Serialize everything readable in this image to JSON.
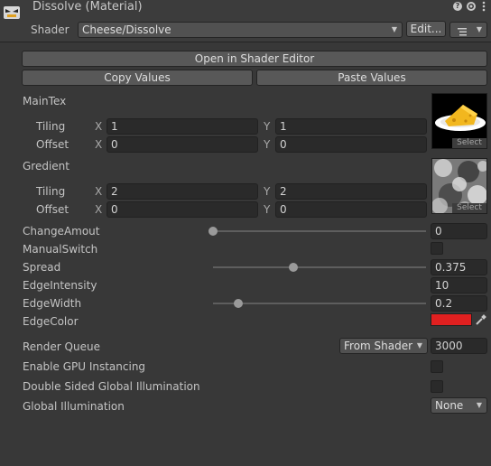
{
  "header": {
    "title": "Dissolve (Material)",
    "shader_label": "Shader",
    "shader_value": "Cheese/Dissolve",
    "edit_label": "Edit...",
    "menu_icon": "list-menu-icon",
    "help_icon": "help-icon",
    "settings_icon": "settings-icon",
    "more_icon": "kebab-icon"
  },
  "actions": {
    "open_shader_editor": "Open in Shader Editor",
    "copy_values": "Copy Values",
    "paste_values": "Paste Values"
  },
  "textures": [
    {
      "name": "MainTex",
      "tiling_label": "Tiling",
      "offset_label": "Offset",
      "tiling_x": "1",
      "tiling_y": "1",
      "offset_x": "0",
      "offset_y": "0",
      "select_label": "Select"
    },
    {
      "name": "Gredient",
      "tiling_label": "Tiling",
      "offset_label": "Offset",
      "tiling_x": "2",
      "tiling_y": "2",
      "offset_x": "0",
      "offset_y": "0",
      "select_label": "Select"
    }
  ],
  "axis": {
    "x": "X",
    "y": "Y"
  },
  "properties": {
    "change_amount": {
      "label": "ChangeAmout",
      "value": "0",
      "slider_fraction": 0.0
    },
    "manual_switch": {
      "label": "ManualSwitch",
      "checked": false
    },
    "spread": {
      "label": "Spread",
      "value": "0.375",
      "slider_fraction": 0.375
    },
    "edge_intensity": {
      "label": "EdgeIntensity",
      "value": "10"
    },
    "edge_width": {
      "label": "EdgeWidth",
      "value": "0.2",
      "slider_fraction": 0.12
    },
    "edge_color": {
      "label": "EdgeColor",
      "color": "#e02020"
    }
  },
  "advanced": {
    "render_queue_label": "Render Queue",
    "render_queue_mode": "From Shader",
    "render_queue_value": "3000",
    "gpu_instancing_label": "Enable GPU Instancing",
    "double_sided_gi_label": "Double Sided Global Illumination",
    "global_illumination_label": "Global Illumination",
    "global_illumination_value": "None"
  }
}
